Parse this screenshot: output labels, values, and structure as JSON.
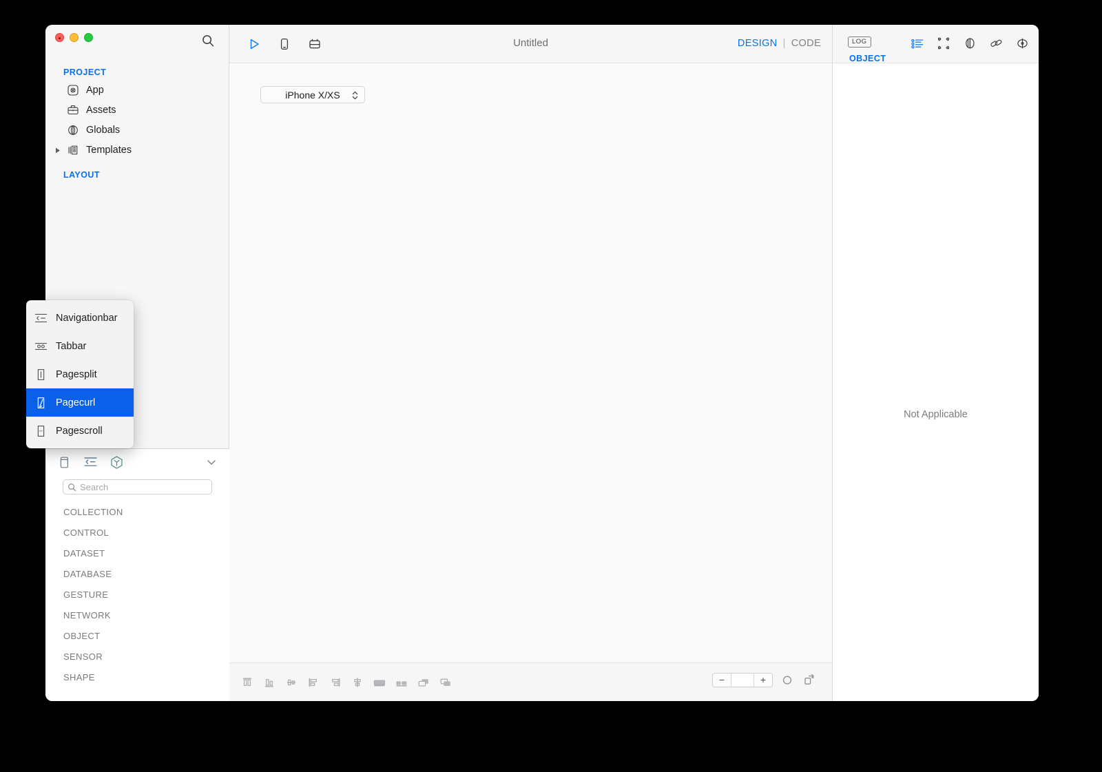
{
  "window": {
    "traffic_lights": [
      "close",
      "minimize",
      "zoom"
    ]
  },
  "sidebar": {
    "search_icon": "search-icon",
    "groups": [
      {
        "label": "PROJECT"
      },
      {
        "label": "LAYOUT"
      }
    ],
    "items": [
      {
        "label": "App",
        "icon": "app-icon",
        "disclosure": false
      },
      {
        "label": "Assets",
        "icon": "briefcase-icon",
        "disclosure": false
      },
      {
        "label": "Globals",
        "icon": "globe-icon",
        "disclosure": false
      },
      {
        "label": "Templates",
        "icon": "templates-icon",
        "disclosure": true
      }
    ]
  },
  "library": {
    "tabs": [
      {
        "name": "page-tab",
        "icon": "page-icon"
      },
      {
        "name": "component-tab",
        "icon": "navbar-icon"
      },
      {
        "name": "object-tab",
        "icon": "cube-icon"
      }
    ],
    "collapse_icon": "chevron-down-icon",
    "search": {
      "placeholder": "Search",
      "value": "",
      "icon": "search-icon"
    },
    "categories": [
      "COLLECTION",
      "CONTROL",
      "DATASET",
      "DATABASE",
      "GESTURE",
      "NETWORK",
      "OBJECT",
      "SENSOR",
      "SHAPE"
    ]
  },
  "toolbar": {
    "buttons": [
      {
        "name": "run-button",
        "icon": "play-icon"
      },
      {
        "name": "preview-button",
        "icon": "phone-icon"
      },
      {
        "name": "component-button",
        "icon": "toolbox-icon"
      }
    ],
    "title": "Untitled",
    "mode": {
      "design_label": "DESIGN",
      "separator": "|",
      "code_label": "CODE",
      "active": "DESIGN"
    }
  },
  "canvas": {
    "device_select": {
      "value": "iPhone X/XS",
      "chevron": "chevron-updown-icon"
    }
  },
  "bottom_bar": {
    "align_buttons": [
      {
        "name": "align-top-button",
        "icon": "align-top-icon"
      },
      {
        "name": "align-bottom-button",
        "icon": "align-bottom-icon"
      },
      {
        "name": "align-center-vertical-button",
        "icon": "align-center-v-icon"
      },
      {
        "name": "align-left-button",
        "icon": "align-left-icon"
      },
      {
        "name": "align-right-button",
        "icon": "align-right-icon"
      },
      {
        "name": "align-center-horizontal-button",
        "icon": "align-center-h-icon"
      },
      {
        "name": "distribute-horizontal-button",
        "icon": "distribute-h-icon"
      },
      {
        "name": "distribute-vertical-button",
        "icon": "distribute-v-icon"
      },
      {
        "name": "bring-forward-button",
        "icon": "bring-forward-icon"
      },
      {
        "name": "send-backward-button",
        "icon": "send-backward-icon"
      }
    ],
    "zoom": {
      "minus_label": "−",
      "plus_label": "+",
      "value": "",
      "fit_icon": "zoom-fit-icon",
      "duplicate_icon": "copy-icon"
    }
  },
  "inspector": {
    "log_label": "LOG",
    "section_label": "OBJECT",
    "icons": [
      {
        "name": "attributes-icon",
        "glyph": "list-icon"
      },
      {
        "name": "layout-icon",
        "glyph": "bounding-box-icon"
      },
      {
        "name": "style-icon",
        "glyph": "shape-icon"
      },
      {
        "name": "link-icon",
        "glyph": "chain-icon"
      },
      {
        "name": "preview-icon",
        "glyph": "aperture-icon"
      }
    ],
    "empty_message": "Not Applicable"
  },
  "context_menu": {
    "items": [
      {
        "label": "Navigationbar",
        "icon": "navigationbar-icon",
        "selected": false
      },
      {
        "label": "Tabbar",
        "icon": "tabbar-icon",
        "selected": false
      },
      {
        "label": "Pagesplit",
        "icon": "pagesplit-icon",
        "selected": false
      },
      {
        "label": "Pagecurl",
        "icon": "pagecurl-icon",
        "selected": true
      },
      {
        "label": "Pagescroll",
        "icon": "pagescroll-icon",
        "selected": false
      }
    ]
  },
  "colors": {
    "accent": "#0a70ec",
    "selection": "#0a60e8",
    "sidebar_bg": "#f6f6f6",
    "canvas_bg": "#fafafa",
    "text": "#1d1d1f",
    "muted": "#7a7a7f"
  }
}
